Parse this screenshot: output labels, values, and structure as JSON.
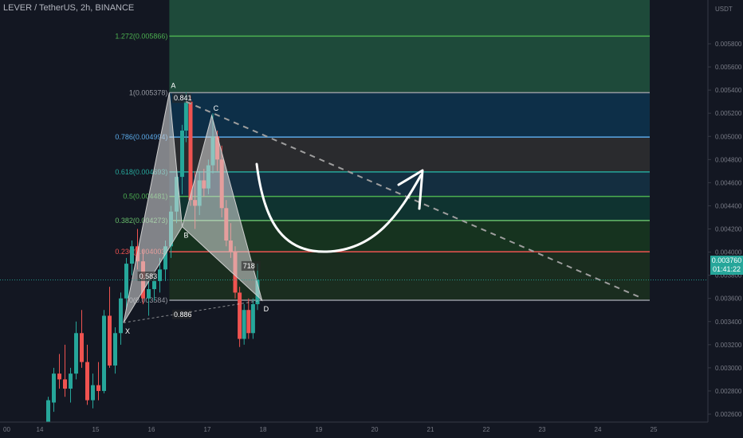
{
  "symbol_title": "LEVER / TetherUS, 2h, BINANCE",
  "currency": "USDT",
  "last_price": {
    "value": "0.003760",
    "countdown": "01:41:22",
    "color": "#26a69a"
  },
  "colors": {
    "up": "#26a69a",
    "down": "#ef5350",
    "background": "#131722"
  },
  "chart_data": {
    "type": "candlestick",
    "x_ticks": [
      "00",
      "14",
      "15",
      "16",
      "17",
      "18",
      "19",
      "20",
      "21",
      "22",
      "23",
      "24",
      "25"
    ],
    "y_ticks": [
      "0.005800",
      "0.005600",
      "0.005400",
      "0.005200",
      "0.005000",
      "0.004800",
      "0.004600",
      "0.004400",
      "0.004200",
      "0.004000",
      "0.003800",
      "0.003600",
      "0.003400",
      "0.003200",
      "0.003000",
      "0.002800",
      "0.002600"
    ],
    "ylim": [
      0.0025,
      0.0059
    ],
    "candles": [
      {
        "t": 14.15,
        "o": 0.00252,
        "h": 0.00275,
        "l": 0.0025,
        "c": 0.00272
      },
      {
        "t": 14.25,
        "o": 0.0027,
        "h": 0.003,
        "l": 0.00262,
        "c": 0.00295
      },
      {
        "t": 14.35,
        "o": 0.00295,
        "h": 0.00312,
        "l": 0.00282,
        "c": 0.0029
      },
      {
        "t": 14.45,
        "o": 0.0029,
        "h": 0.0032,
        "l": 0.00275,
        "c": 0.00282
      },
      {
        "t": 14.55,
        "o": 0.00282,
        "h": 0.003,
        "l": 0.0027,
        "c": 0.00295
      },
      {
        "t": 14.65,
        "o": 0.00295,
        "h": 0.0034,
        "l": 0.0029,
        "c": 0.0033
      },
      {
        "t": 14.75,
        "o": 0.0033,
        "h": 0.0035,
        "l": 0.003,
        "c": 0.00305
      },
      {
        "t": 14.85,
        "o": 0.00305,
        "h": 0.0032,
        "l": 0.00268,
        "c": 0.00272
      },
      {
        "t": 14.95,
        "o": 0.00272,
        "h": 0.00295,
        "l": 0.00265,
        "c": 0.00285
      },
      {
        "t": 15.05,
        "o": 0.00285,
        "h": 0.00305,
        "l": 0.00272,
        "c": 0.0028
      },
      {
        "t": 15.15,
        "o": 0.0028,
        "h": 0.0035,
        "l": 0.00278,
        "c": 0.00345
      },
      {
        "t": 15.25,
        "o": 0.00345,
        "h": 0.0037,
        "l": 0.003,
        "c": 0.00302
      },
      {
        "t": 15.35,
        "o": 0.00302,
        "h": 0.00335,
        "l": 0.00295,
        "c": 0.0033
      },
      {
        "t": 15.45,
        "o": 0.0033,
        "h": 0.00365,
        "l": 0.0032,
        "c": 0.0036
      },
      {
        "t": 15.55,
        "o": 0.0036,
        "h": 0.00395,
        "l": 0.0035,
        "c": 0.0039
      },
      {
        "t": 15.65,
        "o": 0.0039,
        "h": 0.0041,
        "l": 0.0038,
        "c": 0.00405
      },
      {
        "t": 15.75,
        "o": 0.00405,
        "h": 0.0042,
        "l": 0.00385,
        "c": 0.00392
      },
      {
        "t": 15.85,
        "o": 0.00392,
        "h": 0.00402,
        "l": 0.00355,
        "c": 0.0036
      },
      {
        "t": 15.95,
        "o": 0.0036,
        "h": 0.00375,
        "l": 0.00345,
        "c": 0.00368
      },
      {
        "t": 16.05,
        "o": 0.00368,
        "h": 0.0038,
        "l": 0.00358,
        "c": 0.00375
      },
      {
        "t": 16.15,
        "o": 0.00375,
        "h": 0.00395,
        "l": 0.00365,
        "c": 0.00385
      },
      {
        "t": 16.25,
        "o": 0.00385,
        "h": 0.0041,
        "l": 0.00375,
        "c": 0.00405
      },
      {
        "t": 16.35,
        "o": 0.00405,
        "h": 0.0044,
        "l": 0.00395,
        "c": 0.00435
      },
      {
        "t": 16.45,
        "o": 0.00435,
        "h": 0.0047,
        "l": 0.00425,
        "c": 0.00465
      },
      {
        "t": 16.55,
        "o": 0.00465,
        "h": 0.0051,
        "l": 0.0045,
        "c": 0.00505
      },
      {
        "t": 16.62,
        "o": 0.00505,
        "h": 0.00538,
        "l": 0.00495,
        "c": 0.0053
      },
      {
        "t": 16.7,
        "o": 0.0053,
        "h": 0.00535,
        "l": 0.0044,
        "c": 0.00445
      },
      {
        "t": 16.78,
        "o": 0.00445,
        "h": 0.0047,
        "l": 0.0042,
        "c": 0.0044
      },
      {
        "t": 16.86,
        "o": 0.0044,
        "h": 0.0047,
        "l": 0.00432,
        "c": 0.00462
      },
      {
        "t": 16.94,
        "o": 0.00462,
        "h": 0.00472,
        "l": 0.00448,
        "c": 0.00455
      },
      {
        "t": 17.02,
        "o": 0.00455,
        "h": 0.0048,
        "l": 0.0045,
        "c": 0.00475
      },
      {
        "t": 17.1,
        "o": 0.00475,
        "h": 0.0052,
        "l": 0.00468,
        "c": 0.005
      },
      {
        "t": 17.18,
        "o": 0.005,
        "h": 0.00505,
        "l": 0.0047,
        "c": 0.0048
      },
      {
        "t": 17.26,
        "o": 0.0048,
        "h": 0.00492,
        "l": 0.0043,
        "c": 0.00438
      },
      {
        "t": 17.34,
        "o": 0.00438,
        "h": 0.00445,
        "l": 0.00405,
        "c": 0.0041
      },
      {
        "t": 17.42,
        "o": 0.0041,
        "h": 0.00425,
        "l": 0.00395,
        "c": 0.004
      },
      {
        "t": 17.5,
        "o": 0.004,
        "h": 0.00405,
        "l": 0.0036,
        "c": 0.00365
      },
      {
        "t": 17.58,
        "o": 0.00365,
        "h": 0.0037,
        "l": 0.00318,
        "c": 0.00325
      },
      {
        "t": 17.66,
        "o": 0.00325,
        "h": 0.00355,
        "l": 0.0032,
        "c": 0.0035
      },
      {
        "t": 17.74,
        "o": 0.0035,
        "h": 0.0036,
        "l": 0.00325,
        "c": 0.0033
      },
      {
        "t": 17.82,
        "o": 0.0033,
        "h": 0.0036,
        "l": 0.00325,
        "c": 0.00355
      },
      {
        "t": 17.9,
        "o": 0.00355,
        "h": 0.0039,
        "l": 0.0035,
        "c": 0.00376
      }
    ],
    "fib_levels": [
      {
        "label": "1.272(0.005866)",
        "price": 0.005866,
        "color": "#4caf50",
        "fill": "#1e4a3a"
      },
      {
        "label": "1(0.005378)",
        "price": 0.005378,
        "color": "#9598a1",
        "fill": "#0d2f48"
      },
      {
        "label": "0.786(0.004994)",
        "price": 0.004994,
        "color": "#5aa8e6",
        "fill": "#2a2b2e"
      },
      {
        "label": "0.618(0.004693)",
        "price": 0.004693,
        "color": "#26a69a",
        "fill": "#142e40"
      },
      {
        "label": "0.5(0.004481)",
        "price": 0.004481,
        "color": "#4caf50",
        "fill": "#0f3330"
      },
      {
        "label": "0.382(0.004273)",
        "price": 0.004273,
        "color": "#66bb6a",
        "fill": "#16331f"
      },
      {
        "label": "0.236(0.004003)",
        "price": 0.004003,
        "color": "#ef5350",
        "fill": "#1a2d1f"
      },
      {
        "label": "0(0.003584)",
        "price": 0.003584,
        "color": "#9598a1",
        "fill": "#3a1315"
      }
    ],
    "harmonic": {
      "points": [
        {
          "name": "X",
          "t": 15.5,
          "p": 0.00339
        },
        {
          "name": "A",
          "t": 16.32,
          "p": 0.005378
        },
        {
          "name": "B",
          "t": 16.55,
          "p": 0.00422
        },
        {
          "name": "C",
          "t": 17.08,
          "p": 0.00518
        },
        {
          "name": "D",
          "t": 17.98,
          "p": 0.003584
        }
      ],
      "ratios": [
        {
          "text": "0.841",
          "t": 16.4,
          "p": 0.00531
        },
        {
          "text": "0.583",
          "t": 15.78,
          "p": 0.00377
        },
        {
          "text": "718",
          "t": 17.64,
          "p": 0.00386
        },
        {
          "text": "0.886",
          "t": 16.4,
          "p": 0.00344
        }
      ]
    },
    "trendline": {
      "t1": 16.62,
      "p1": 0.0053,
      "t2": 24.8,
      "p2": 0.0036
    }
  }
}
